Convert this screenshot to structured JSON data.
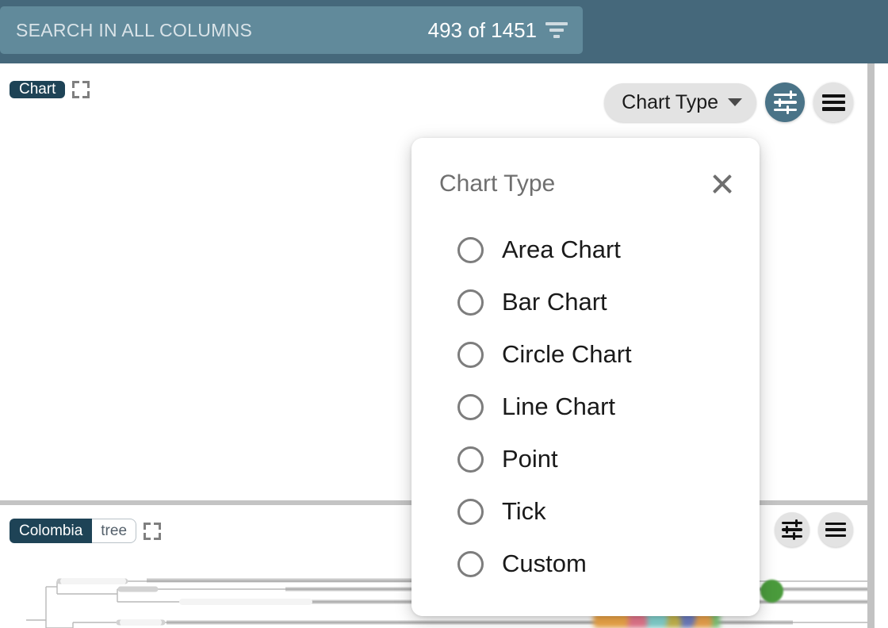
{
  "search_bar": {
    "placeholder": "SEARCH IN ALL COLUMNS",
    "count_text": "493 of 1451",
    "filter_icon": "filter-funnel-icon"
  },
  "chart_panel": {
    "tag": "Chart",
    "expand_icon": "expand-fullscreen-icon",
    "chart_type_button": "Chart Type",
    "caret_icon": "chevron-down-icon",
    "settings_icon": "sliders-settings-icon",
    "menu_icon": "hamburger-menu-icon"
  },
  "tree_panel": {
    "tag": "Colombia",
    "subtag": "tree",
    "expand_icon": "expand-fullscreen-icon",
    "settings_icon": "sliders-settings-icon",
    "menu_icon": "hamburger-menu-icon"
  },
  "modal": {
    "title": "Chart Type",
    "close_icon": "close-x-icon",
    "options": [
      {
        "label": "Area Chart",
        "selected": false
      },
      {
        "label": "Bar Chart",
        "selected": false
      },
      {
        "label": "Circle Chart",
        "selected": false
      },
      {
        "label": "Line Chart",
        "selected": false
      },
      {
        "label": "Point",
        "selected": false
      },
      {
        "label": "Tick",
        "selected": false
      },
      {
        "label": "Custom",
        "selected": false
      }
    ]
  },
  "colors": {
    "topbar": "#45687b",
    "search_field": "#618a9b",
    "tag_dark": "#1e4356",
    "accent_teal": "#4a7387",
    "button_grey": "#e3e3e3",
    "marker_green": "#4a9b3c",
    "divider": "#c4c4c4"
  }
}
